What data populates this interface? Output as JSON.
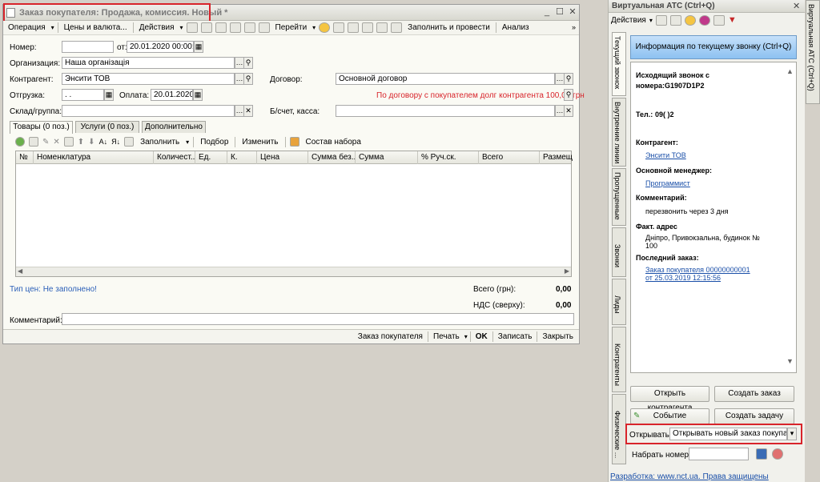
{
  "order_window": {
    "title": "Заказ покупателя: Продажа, комиссия. Новый *",
    "toolbar": [
      "Операция",
      "Цены и валюта...",
      "Действия",
      "Перейти",
      "Заполнить и провести",
      "Анализ"
    ],
    "fields": {
      "number_label": "Номер:",
      "number_value": "",
      "date_label": "от:",
      "date_value": "20.01.2020 00:00:00",
      "org_label": "Организация:",
      "org_value": "Наша організація",
      "contractor_label": "Контрагент:",
      "contractor_value": "Энсити ТОВ",
      "contract_label": "Договор:",
      "contract_value": "Основной договор",
      "shipment_label": "Отгрузка:",
      "shipment_value": ". .",
      "payment_label": "Оплата:",
      "payment_value": "20.01.2020",
      "debt_warning": "По договору с покупателем долг контрагента 100,00 грн",
      "warehouse_label": "Склад/группа:",
      "warehouse_value": "",
      "account_label": "Б/счет, касса:",
      "account_value": ""
    },
    "tabs": [
      "Товары (0 поз.)",
      "Услуги (0 поз.)",
      "Дополнительно"
    ],
    "grid_toolbar": [
      "Заполнить",
      "Подбор",
      "Изменить",
      "Состав набора"
    ],
    "columns": [
      "№",
      "Номенклатура",
      "Количест...",
      "Ед.",
      "К.",
      "Цена",
      "Сумма без...",
      "Сумма",
      "% Руч.ск.",
      "Всего",
      "Размещени"
    ],
    "price_type": "Тип цен: Не заполнено!",
    "total_label": "Всего (грн):",
    "total_value": "0,00",
    "vat_label": "НДС (сверху):",
    "vat_value": "0,00",
    "comment_label": "Комментарий:",
    "bottom": [
      "Заказ покупателя",
      "Печать",
      "OK",
      "Записать",
      "Закрыть"
    ]
  },
  "ats": {
    "title": "Виртуальная АТС (Ctrl+Q)",
    "actions_label": "Действия",
    "side_tab": "Виртуальная АТС (Ctrl+Q)",
    "vtabs": [
      "Текущий звонок",
      "Внутренние линии",
      "Пропущенные",
      "Звонки",
      "Лиды",
      "Контрагенты",
      "Физические ..."
    ],
    "info_button": "Информация по текущему звонку (Ctrl+Q)",
    "call_title_1": "Исходящий звонок с",
    "call_title_2": "номера:G1907D1P2",
    "phone_label": "Тел.:",
    "phone_value": "09(        )2",
    "contractor_label": "Контрагент:",
    "contractor_value": "Энсити ТОВ",
    "manager_label": "Основной менеджер:",
    "manager_value": "Программист",
    "comment_label": "Комментарий:",
    "comment_value": "перезвонить через 3 дня",
    "address_label": "Факт. адрес",
    "address_line1": "Дніпро, Привокзальна, будинок №",
    "address_line2": "100",
    "last_order_label": "Последний заказ:",
    "last_order_line1": "Заказ покупателя 00000000001",
    "last_order_line2": "от 25.03.2019 12:15:56",
    "btn_open_contractor": "Открыть контрагента",
    "btn_create_order": "Создать заказ",
    "btn_event": "Событие",
    "btn_create_task": "Создать задачу",
    "open_label": "Открывать:",
    "open_value": "Открывать новый заказ покупателя",
    "dial_label": "Набрать номер:",
    "dial_value": "",
    "footer": "Разработка: www.nct.ua. Права защищены"
  },
  "colors": {
    "highlight": "#d8242b",
    "link": "#1a4fa8",
    "warning": "#d8242b"
  }
}
